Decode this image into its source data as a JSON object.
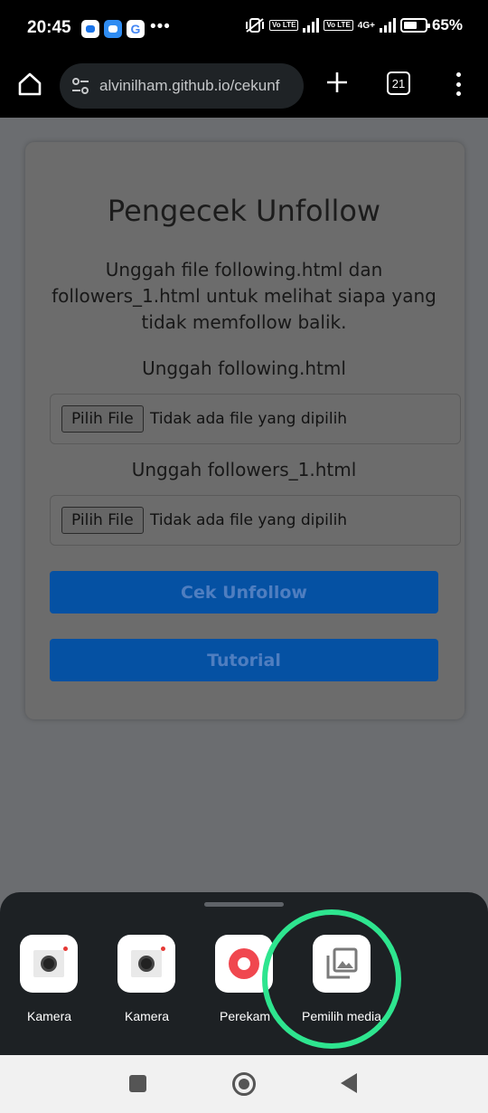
{
  "status_bar": {
    "time": "20:45",
    "more": "•••",
    "google_glyph": "G",
    "lte_1": "Vo LTE",
    "lte_2": "Vo LTE",
    "network": "4G+",
    "battery": "65%",
    "battery_level": 0.65
  },
  "browser": {
    "url": "alvinilham.github.io/cekunf",
    "tab_count": "21",
    "icons": [
      "home-icon",
      "tune-icon",
      "plus-icon",
      "tabs-icon",
      "more-vertical-icon"
    ]
  },
  "page": {
    "title": "Pengecek Unfollow",
    "description": "Unggah file following.html dan followers_1.html untuk melihat siapa yang tidak memfollow balik.",
    "upload_following_label": "Unggah following.html",
    "upload_followers_label": "Unggah followers_1.html",
    "file_button_label": "Pilih File",
    "file_status": "Tidak ada file yang dipilih",
    "check_button": "Cek Unfollow",
    "tutorial_button": "Tutorial"
  },
  "picker": {
    "apps": [
      {
        "label": "Kamera",
        "icon": "camera-icon"
      },
      {
        "label": "Kamera",
        "icon": "camera-icon"
      },
      {
        "label": "Perekam",
        "icon": "recorder-icon"
      },
      {
        "label": "Pemilih media",
        "icon": "media-picker-icon"
      }
    ],
    "highlight_color": "#2ee58f"
  },
  "nav_bar": {
    "icons": [
      "recents-icon",
      "home-circle-icon",
      "back-icon"
    ]
  }
}
